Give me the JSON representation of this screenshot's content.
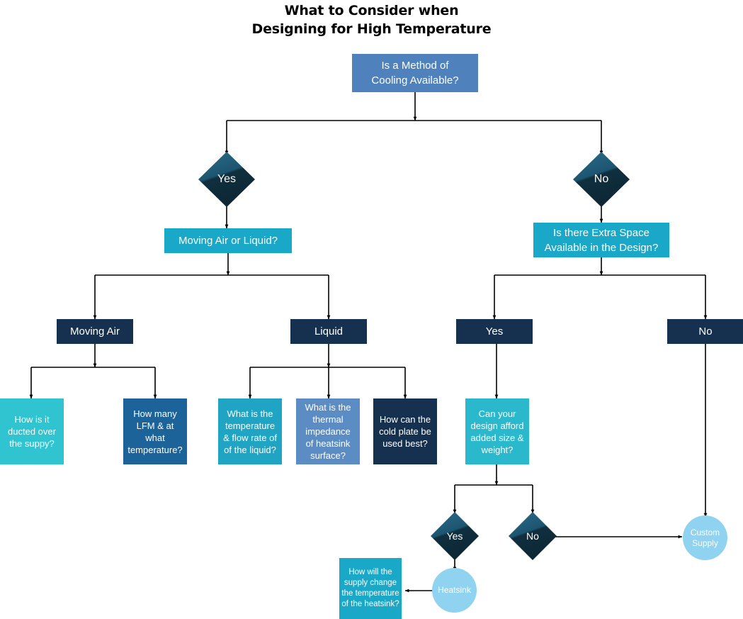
{
  "title": "What to Consider when\nDesigning for High Temperature",
  "colors": {
    "background": "#ffffff",
    "edge": "#000000",
    "root_blue": "#4f81bd",
    "cyan": "#29b6ce",
    "teal": "#2ab5c4",
    "cyan_bright": "#2fc4cf",
    "steel_blue": "#5b8cc4",
    "medium_blue": "#1b6399",
    "navy": "#15314f",
    "navy_dark": "#112d4a",
    "light_blue": "#8fd3f0",
    "diamond_light": "#23607c",
    "diamond_dark": "#10303f",
    "text": "#ffffff"
  },
  "nodes": {
    "root": {
      "label": "Is a Method of\nCooling Available?",
      "type": "box",
      "color": "#4f81bd"
    },
    "yes_top": {
      "label": "Yes",
      "type": "diamond"
    },
    "no_top": {
      "label": "No",
      "type": "diamond"
    },
    "moving_air_or_liquid": {
      "label": "Moving Air or Liquid?",
      "type": "box",
      "color": "#1aa8c8"
    },
    "extra_space": {
      "label": "Is there Extra Space\nAvailable in the Design?",
      "type": "box",
      "color": "#1aa8c8"
    },
    "moving_air": {
      "label": "Moving Air",
      "type": "box",
      "color": "#15314f"
    },
    "liquid": {
      "label": "Liquid",
      "type": "box",
      "color": "#15314f"
    },
    "space_yes": {
      "label": "Yes",
      "type": "box",
      "color": "#15314f"
    },
    "space_no": {
      "label": "No",
      "type": "box",
      "color": "#15314f"
    },
    "ducted": {
      "label": "How is it\nducted over\nthe suppy?",
      "type": "box",
      "color": "#2fc4cf"
    },
    "lfm": {
      "label": "How many\nLFM & at\nwhat\ntemperature?",
      "type": "box",
      "color": "#1b6399"
    },
    "liquid_temp": {
      "label": "What is the\ntemperature\n& flow rate of\nof the liquid?",
      "type": "box",
      "color": "#20a4c4"
    },
    "thermal_impedance": {
      "label": "What is the\nthermal\nimpedance\nof heatsink\nsurface?",
      "type": "box",
      "color": "#5b8cc4"
    },
    "cold_plate": {
      "label": "How can the\ncold plate be\nused best?",
      "type": "box",
      "color": "#15314f"
    },
    "afford": {
      "label": "Can your\ndesign afford\nadded size &\nweight?",
      "type": "box",
      "color": "#2ab9cc"
    },
    "afford_yes": {
      "label": "Yes",
      "type": "diamond"
    },
    "afford_no": {
      "label": "No",
      "type": "diamond"
    },
    "heatsink": {
      "label": "Heatsink",
      "type": "circle",
      "color": "#8fd3f0"
    },
    "custom_supply": {
      "label": "Custom\nSupply",
      "type": "circle",
      "color": "#8fd3f0"
    },
    "supply_change": {
      "label": "How will the\nsupply change\nthe temperature\nof the heatsink?",
      "type": "box",
      "color": "#1aa8c8"
    }
  },
  "flow": {
    "edges": [
      {
        "from": "root",
        "to": "yes_top",
        "label": ""
      },
      {
        "from": "root",
        "to": "no_top",
        "label": ""
      },
      {
        "from": "yes_top",
        "to": "moving_air_or_liquid",
        "label": ""
      },
      {
        "from": "no_top",
        "to": "extra_space",
        "label": ""
      },
      {
        "from": "moving_air_or_liquid",
        "to": "moving_air",
        "label": ""
      },
      {
        "from": "moving_air_or_liquid",
        "to": "liquid",
        "label": ""
      },
      {
        "from": "extra_space",
        "to": "space_yes",
        "label": ""
      },
      {
        "from": "extra_space",
        "to": "space_no",
        "label": ""
      },
      {
        "from": "moving_air",
        "to": "ducted",
        "label": ""
      },
      {
        "from": "moving_air",
        "to": "lfm",
        "label": ""
      },
      {
        "from": "liquid",
        "to": "liquid_temp",
        "label": ""
      },
      {
        "from": "liquid",
        "to": "thermal_impedance",
        "label": ""
      },
      {
        "from": "liquid",
        "to": "cold_plate",
        "label": ""
      },
      {
        "from": "space_yes",
        "to": "afford",
        "label": ""
      },
      {
        "from": "space_no",
        "to": "custom_supply",
        "label": ""
      },
      {
        "from": "afford",
        "to": "afford_yes",
        "label": ""
      },
      {
        "from": "afford",
        "to": "afford_no",
        "label": ""
      },
      {
        "from": "afford_yes",
        "to": "heatsink",
        "label": ""
      },
      {
        "from": "afford_no",
        "to": "custom_supply",
        "label": ""
      },
      {
        "from": "heatsink",
        "to": "supply_change",
        "label": ""
      }
    ]
  }
}
